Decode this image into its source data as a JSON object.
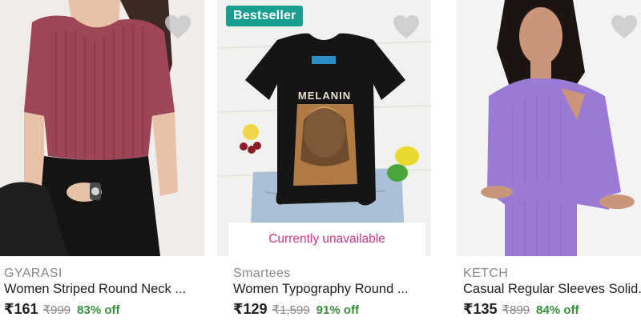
{
  "products": [
    {
      "brand": "GYARASI",
      "title": "Women Striped Round Neck ...",
      "price": "₹161",
      "mrp": "₹999",
      "discount": "83% off",
      "image_icon": "maroon-ribbed-top-image"
    },
    {
      "badge": "Bestseller",
      "brand": "Smartees",
      "title": "Women Typography Round ...",
      "price": "₹129",
      "mrp": "₹1,599",
      "discount": "91% off",
      "availability": "Currently unavailable",
      "print_text": "MELANIN",
      "image_icon": "black-typography-tshirt-image"
    },
    {
      "brand": "KETCH",
      "title": "Casual Regular Sleeves Solid...",
      "price": "₹135",
      "mrp": "₹899",
      "discount": "84% off",
      "image_icon": "lavender-cutout-top-image"
    }
  ],
  "colors": {
    "badge": "#1a9e8f",
    "discount": "#388e3c",
    "unavailable": "#d63384",
    "muted": "#878787"
  }
}
